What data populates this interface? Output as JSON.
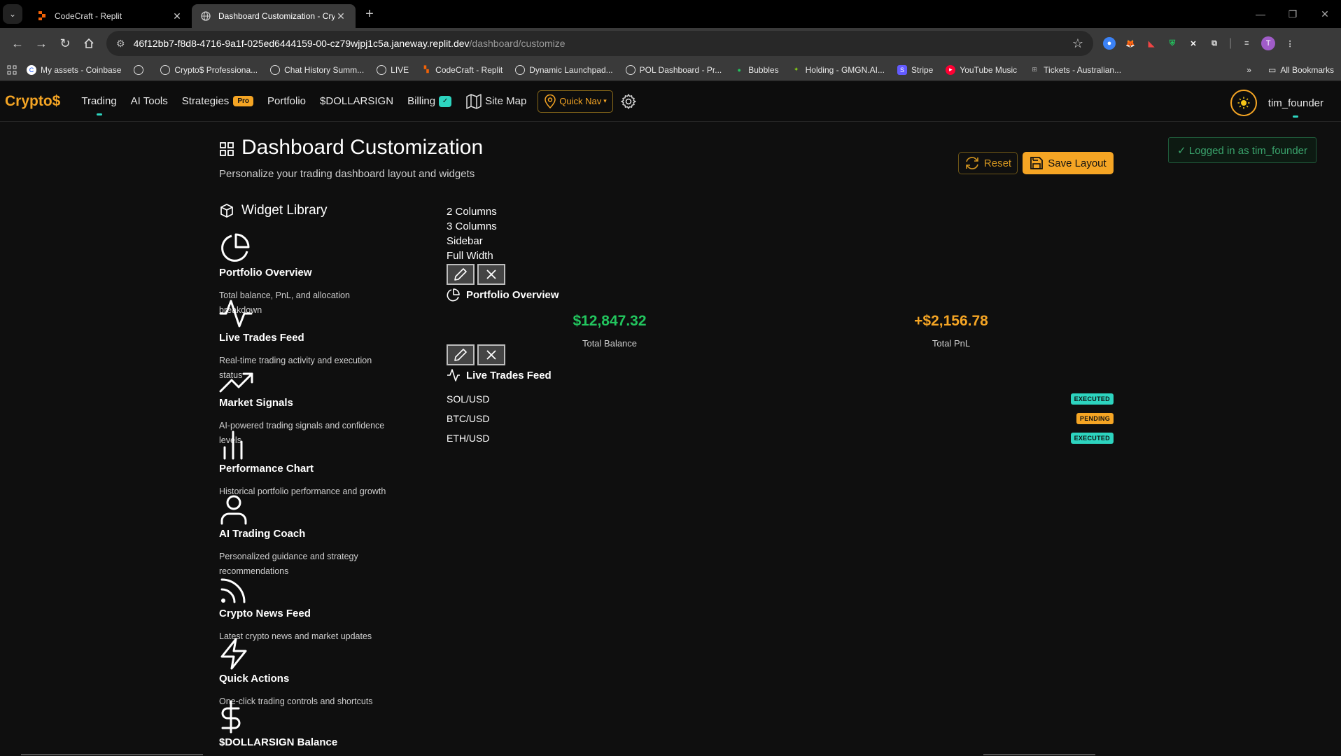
{
  "browser": {
    "tabs": [
      {
        "title": "CodeCraft - Replit",
        "icon": "replit-icon"
      },
      {
        "title": "Dashboard Customization - Cry",
        "icon": "globe-icon"
      }
    ],
    "url_host": "46f12bb7-f8d8-4716-9a1f-025ed6444159-00-cz79wjpj1c5a.janeway.replit.dev",
    "url_path": "/dashboard/customize",
    "bookmarks": [
      "My assets - Coinbase",
      "",
      "Crypto$ Professiona...",
      "Chat History Summ...",
      "LIVE",
      "CodeCraft - Replit",
      "Dynamic Launchpad...",
      "POL Dashboard - Pr...",
      "Bubbles",
      "Holding - GMGN.AI...",
      "Stripe",
      "YouTube Music",
      "Tickets - Australian..."
    ],
    "more_bookmarks": "»",
    "all_bookmarks": "All Bookmarks",
    "profile_initial": "T"
  },
  "nav": {
    "brand": "Crypto$",
    "links": {
      "trading": "Trading",
      "ai_tools": "AI Tools",
      "strategies": "Strategies",
      "pro_badge": "Pro",
      "portfolio": "Portfolio",
      "dollarsign": "$DOLLARSIGN",
      "billing": "Billing",
      "billing_badge": "✓",
      "site_map": "Site Map",
      "quick_nav": "Quick Nav"
    },
    "username": "tim_founder"
  },
  "page": {
    "title": "Dashboard Customization",
    "subtitle": "Personalize your trading dashboard layout and widgets",
    "reset": "Reset",
    "save": "Save Layout",
    "logged_in": "✓ Logged in as tim_founder"
  },
  "library": {
    "title": "Widget Library",
    "widgets": [
      {
        "name": "Portfolio Overview",
        "desc": "Total balance, PnL, and allocation breakdown",
        "icon": "pie-chart-icon"
      },
      {
        "name": "Live Trades Feed",
        "desc": "Real-time trading activity and execution status",
        "icon": "activity-icon"
      },
      {
        "name": "Market Signals",
        "desc": "AI-powered trading signals and confidence levels",
        "icon": "trending-up-icon"
      },
      {
        "name": "Performance Chart",
        "desc": "Historical portfolio performance and growth",
        "icon": "bar-chart-icon"
      },
      {
        "name": "AI Trading Coach",
        "desc": "Personalized guidance and strategy recommendations",
        "icon": "user-icon"
      },
      {
        "name": "Crypto News Feed",
        "desc": "Latest crypto news and market updates",
        "icon": "rss-icon"
      },
      {
        "name": "Quick Actions",
        "desc": "One-click trading controls and shortcuts",
        "icon": "zap-icon"
      },
      {
        "name": "$DOLLARSIGN Balance",
        "desc": "",
        "icon": "dollar-icon"
      }
    ]
  },
  "layout_options": [
    "2 Columns",
    "3 Columns",
    "Sidebar",
    "Full Width"
  ],
  "canvas": {
    "portfolio": {
      "title": "Portfolio Overview",
      "total_balance_value": "$12,847.32",
      "total_balance_label": "Total Balance",
      "total_pnl_value": "+$2,156.78",
      "total_pnl_label": "Total PnL"
    },
    "trades": {
      "title": "Live Trades Feed",
      "rows": [
        {
          "pair": "SOL/USD",
          "status": "EXECUTED"
        },
        {
          "pair": "BTC/USD",
          "status": "PENDING"
        },
        {
          "pair": "ETH/USD",
          "status": "EXECUTED"
        }
      ]
    }
  },
  "colors": {
    "accent_gold": "#f5a524",
    "accent_teal": "#2dd4bf",
    "positive_green": "#22c55e"
  }
}
